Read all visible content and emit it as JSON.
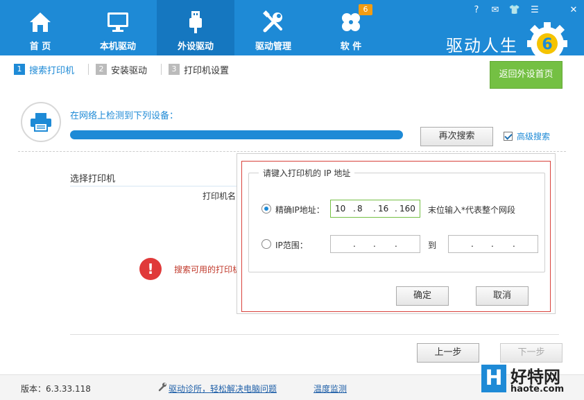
{
  "nav": {
    "items": [
      {
        "label": "首 页",
        "icon": "home-icon"
      },
      {
        "label": "本机驱动",
        "icon": "monitor-icon"
      },
      {
        "label": "外设驱动",
        "icon": "usb-icon"
      },
      {
        "label": "驱动管理",
        "icon": "tools-icon"
      },
      {
        "label": "软 件",
        "icon": "clover-icon"
      }
    ],
    "software_badge": "6",
    "active": "外设驱动"
  },
  "window_controls": [
    "help-icon",
    "feedback-icon",
    "skin-icon",
    "menu-icon",
    "close-icon"
  ],
  "window_controls_glyphs": {
    "help": "?",
    "feedback": "✉",
    "skin": "👕",
    "menu": "☰",
    "close": "✕"
  },
  "brand": {
    "name": "驱动人生",
    "version_badge": "6"
  },
  "steps": [
    {
      "num": "1",
      "label": "搜索打印机"
    },
    {
      "num": "2",
      "label": "安装驱动"
    },
    {
      "num": "3",
      "label": "打印机设置"
    }
  ],
  "return_button": "返回外设首页",
  "detect": {
    "title": "在网络上检测到下列设备：",
    "progress": 1.0,
    "search_again": "再次搜索",
    "advanced_search": "高级搜索",
    "advanced_checked": true
  },
  "list": {
    "select_label": "选择打印机",
    "column_printer": "打印机名",
    "error_text": "搜索可用的打印机"
  },
  "popup": {
    "legend": "请键入打印机的 IP 地址",
    "exact_label": "精确IP地址：",
    "exact_ip": [
      "10",
      "8",
      "16",
      "160"
    ],
    "exact_hint": "末位输入*代表整个网段",
    "range_label": "IP范围：",
    "range_to": "到",
    "selected": "exact",
    "ok": "确定",
    "cancel": "取消"
  },
  "nav_buttons": {
    "prev": "上一步",
    "next": "下一步"
  },
  "footer": {
    "version": "版本：6.3.33.118",
    "diagnose_link": "驱动诊所，轻松解决电脑问题",
    "temp_link": "温度监测"
  },
  "watermark": {
    "text": "好特网",
    "url": "haote.com",
    "letter": "H"
  },
  "colors": {
    "primary": "#1e8ad6",
    "green": "#74c043",
    "error": "#e03a3a"
  }
}
